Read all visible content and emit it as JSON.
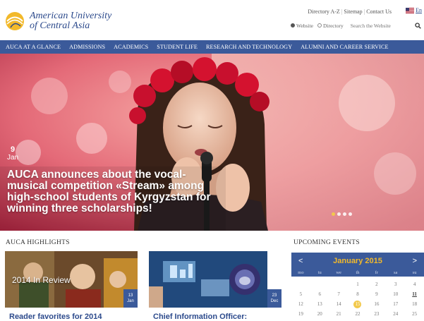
{
  "header": {
    "logo_line1": "American University",
    "logo_line2": "of Central Asia",
    "links": [
      "Directory A-Z",
      "Sitemap",
      "Contact Us"
    ],
    "language": "En",
    "search": {
      "option_website": "Website",
      "option_directory": "Directory",
      "placeholder": "Search the Website"
    }
  },
  "nav": {
    "items": [
      "AUCA AT A GLANCE",
      "ADMISSIONS",
      "ACADEMICS",
      "STUDENT LIFE",
      "RESEARCH AND TECHNOLOGY",
      "ALUMNI AND CAREER SERVICE"
    ]
  },
  "hero": {
    "day": "9",
    "month": "Jan",
    "title": "AUCA announces about the vocal-musical competition «Stream» among high-school students of Kyrgyzstan for winning three scholarships!",
    "slide_count": 4,
    "active_slide": 1
  },
  "highlights": {
    "heading": "AUCA HIGHLIGHTS",
    "cards": [
      {
        "title": "Reader favorites for 2014",
        "image_caption": "2014 In Review",
        "day": "13",
        "month": "Jan"
      },
      {
        "title": "Chief Information Officer:",
        "image_caption": "",
        "day": "23",
        "month": "Dec"
      }
    ]
  },
  "events": {
    "heading": "UPCOMING EVENTS",
    "month": "January 2015",
    "prev": "<",
    "next": ">",
    "dow": [
      "mo",
      "tu",
      "we",
      "th",
      "fr",
      "sa",
      "su"
    ],
    "days": [
      "",
      "",
      "",
      "1",
      "2",
      "3",
      "4",
      "5",
      "6",
      "7",
      "8",
      "9",
      "10",
      "11",
      "12",
      "13",
      "14",
      "15",
      "16",
      "17",
      "18",
      "19",
      "20",
      "21",
      "22",
      "23",
      "24",
      "25"
    ],
    "today": "15",
    "highlighted": "11"
  },
  "colors": {
    "brand_blue": "#3b5a9a",
    "accent_gold": "#f2b92b"
  }
}
